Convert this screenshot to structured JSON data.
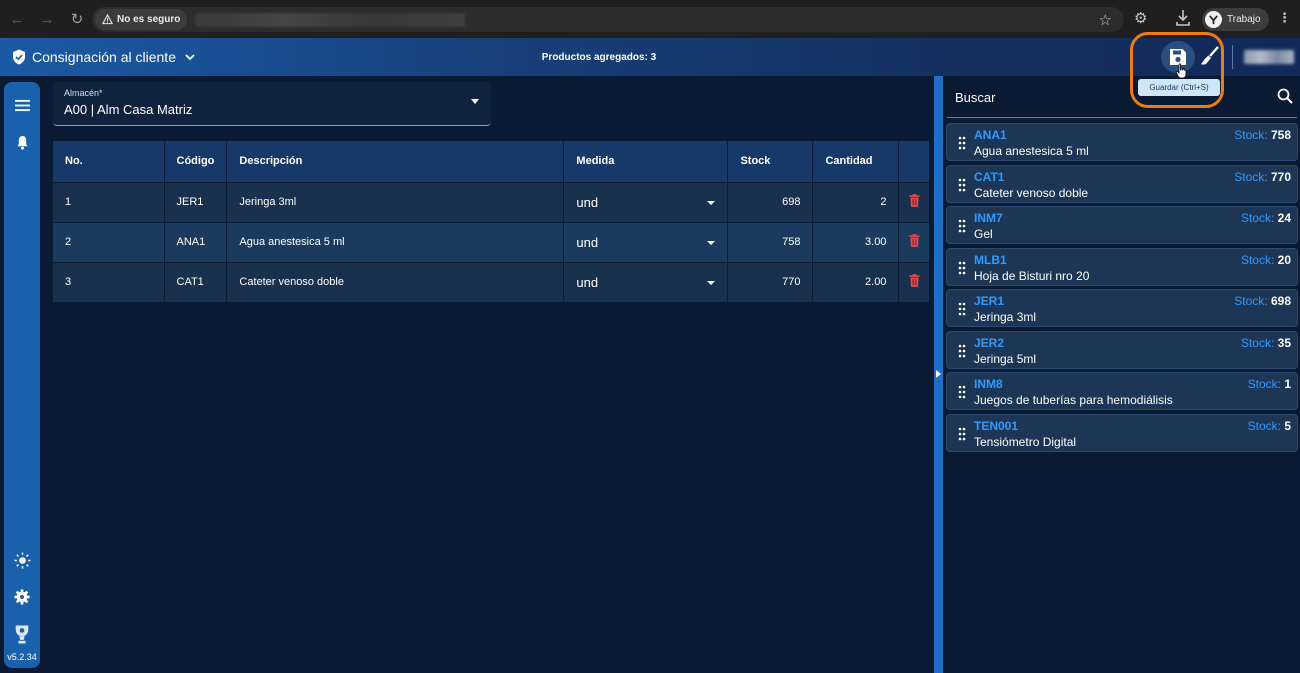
{
  "browser": {
    "security_label": "No es seguro",
    "profile_label": "Trabajo"
  },
  "header": {
    "module_title": "Consignación al cliente",
    "products_added": "Productos agregados: 3",
    "save_tooltip": "Guardar (Ctrl+S)"
  },
  "sidebar": {
    "version": "v5.2.34"
  },
  "warehouse": {
    "label": "Almacén*",
    "value": "A00 | Alm Casa Matriz"
  },
  "table": {
    "headers": {
      "no": "No.",
      "codigo": "Código",
      "descripcion": "Descripción",
      "medida": "Medida",
      "stock": "Stock",
      "cantidad": "Cantidad"
    },
    "rows": [
      {
        "no": "1",
        "codigo": "JER1",
        "descripcion": "Jeringa 3ml",
        "medida": "und",
        "stock": "698",
        "cantidad": "2"
      },
      {
        "no": "2",
        "codigo": "ANA1",
        "descripcion": "Agua anestesica 5 ml",
        "medida": "und",
        "stock": "758",
        "cantidad": "3.00"
      },
      {
        "no": "3",
        "codigo": "CAT1",
        "descripcion": "Cateter venoso doble",
        "medida": "und",
        "stock": "770",
        "cantidad": "2.00"
      }
    ]
  },
  "search": {
    "label": "Buscar",
    "stock_prefix": "Stock:"
  },
  "products": [
    {
      "code": "ANA1",
      "description": "Agua anestesica 5 ml",
      "stock": "758"
    },
    {
      "code": "CAT1",
      "description": "Cateter venoso doble",
      "stock": "770"
    },
    {
      "code": "INM7",
      "description": "Gel",
      "stock": "24"
    },
    {
      "code": "MLB1",
      "description": "Hoja de Bisturi nro 20",
      "stock": "20"
    },
    {
      "code": "JER1",
      "description": "Jeringa 3ml",
      "stock": "698"
    },
    {
      "code": "JER2",
      "description": "Jeringa 5ml",
      "stock": "35"
    },
    {
      "code": "INM8",
      "description": "Juegos de tuberías para hemodiálisis",
      "stock": "1"
    },
    {
      "code": "TEN001",
      "description": "Tensiómetro Digital",
      "stock": "5"
    }
  ],
  "colors": {
    "accent": "#2e9bff",
    "highlight": "#f07a14",
    "delete": "#e5484d"
  }
}
